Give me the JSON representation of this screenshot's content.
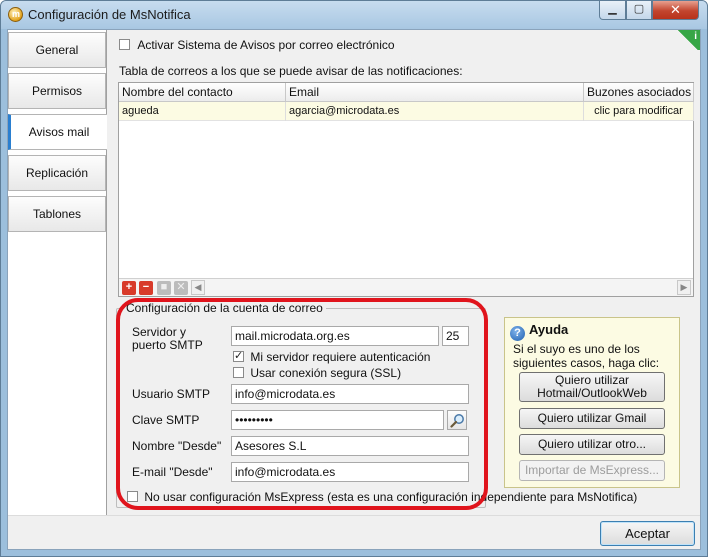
{
  "window": {
    "title": "Configuración de MsNotifica",
    "app_icon_glyph": "m",
    "min_glyph": "▁",
    "max_glyph": "▢",
    "close_glyph": "✕"
  },
  "tabs": [
    {
      "label": "General"
    },
    {
      "label": "Permisos"
    },
    {
      "label": "Avisos mail"
    },
    {
      "label": "Replicación"
    },
    {
      "label": "Tablones"
    }
  ],
  "panel": {
    "info_glyph": "i",
    "activate_label": "Activar Sistema de Avisos por correo electrónico",
    "activate_checked": false,
    "table_caption": "Tabla de correos a los que se puede avisar de las notificaciones:",
    "table": {
      "columns": [
        "Nombre del contacto",
        "Email",
        "Buzones asociados"
      ],
      "rows": [
        [
          "agueda",
          "agarcia@microdata.es",
          "clic para modificar"
        ]
      ]
    },
    "toolbar": {
      "add_glyph": "+",
      "delete_glyph": "−",
      "save_glyph": "■",
      "cancel_glyph": "✕",
      "scroll_left_glyph": "◀",
      "scroll_right_glyph": "▶"
    }
  },
  "account": {
    "legend": "Configuración de la cuenta de correo",
    "server_label_1": "Servidor y",
    "server_label_2": "puerto SMTP",
    "server_value": "mail.microdata.org.es",
    "port_value": "25",
    "auth_label": "Mi servidor requiere autenticación",
    "auth_checked": true,
    "ssl_label": "Usar conexión segura (SSL)",
    "ssl_checked": false,
    "user_label": "Usuario SMTP",
    "user_value": "info@microdata.es",
    "password_label": "Clave SMTP",
    "password_value": "•••••••••",
    "from_name_label": "Nombre \"Desde\"",
    "from_name_value": "Asesores S.L",
    "from_email_label": "E-mail \"Desde\"",
    "from_email_value": "info@microdata.es"
  },
  "help": {
    "icon_glyph": "?",
    "title": "Ayuda",
    "text": "Si el suyo es uno de los siguientes casos, haga clic:",
    "btn_hotmail_1": "Quiero utilizar",
    "btn_hotmail_2": "Hotmail/OutlookWeb",
    "btn_gmail": "Quiero utilizar Gmail",
    "btn_other": "Quiero utilizar otro...",
    "btn_import": "Importar de MsExpress..."
  },
  "no_msexpress_label": "No usar configuración MsExpress (esta es una configuración independiente para MsNotifica)",
  "footer": {
    "ok_label": "Aceptar"
  },
  "colors": {
    "highlight_ring": "#e0141c",
    "active_tab_accent": "#2a7fd0",
    "help_bg": "#fcfbe3"
  }
}
